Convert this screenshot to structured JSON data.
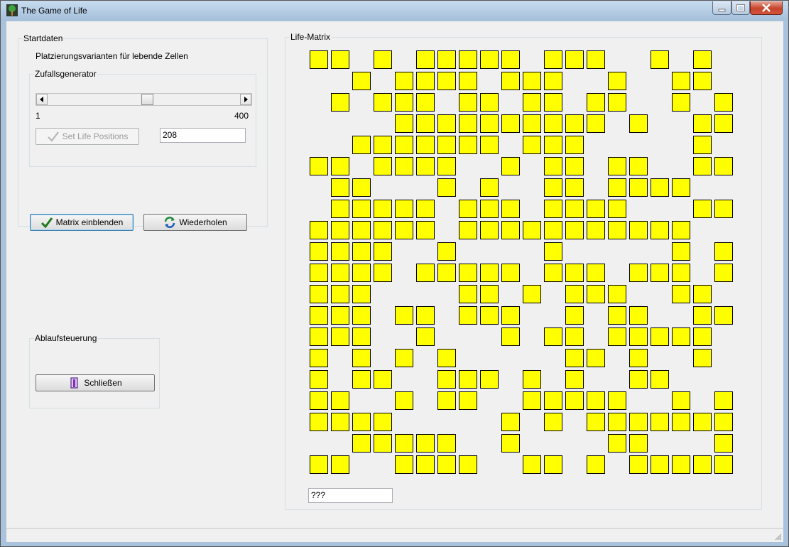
{
  "window": {
    "title": "The Game of Life",
    "icons": {
      "app": "tree-icon",
      "minimize": "minimize-icon",
      "maximize": "maximize-icon",
      "close": "close-icon"
    }
  },
  "startdaten": {
    "group_title": "Startdaten",
    "placement_label": "Platzierungsvarianten für lebende Zellen",
    "zufall": {
      "group_title": "Zufallsgenerator",
      "slider": {
        "min_label": "1",
        "max_label": "400",
        "min": 1,
        "max": 400,
        "value": 208
      },
      "set_button": "Set Life Positions",
      "value_field": "208"
    },
    "matrix_button": "Matrix einblenden",
    "repeat_button": "Wiederholen"
  },
  "ablauf": {
    "group_title": "Ablaufsteuerung",
    "close_button": "Schließen"
  },
  "matrix": {
    "group_title": "Life-Matrix",
    "status_field": "???",
    "rows": [
      "11.1.11111.111..1.1.",
      "..1.1111.111..1..11.",
      ".1.111.11.11.11..1.1",
      "....1111111111.1..11",
      "..1111111.111.....1.",
      "11.1111..1.11.11..11",
      ".11...1.1..11.1111..",
      ".11111.111.1111...11",
      "111111.11111111111..",
      "1111..1....1.....1.1",
      "1111.11111.111.111.1",
      "111....11.1.111..11.",
      "111.11.111..1.11..11",
      "111..1...1.11.11111.",
      "1.1.1.1.....11.1..1.",
      "1.11..111.1.1..11...",
      "11..1.11..11111..1.1",
      "1111.....1.1.1111111",
      "..11111..1....11...1",
      "11..1111..11.1.11111"
    ]
  }
}
